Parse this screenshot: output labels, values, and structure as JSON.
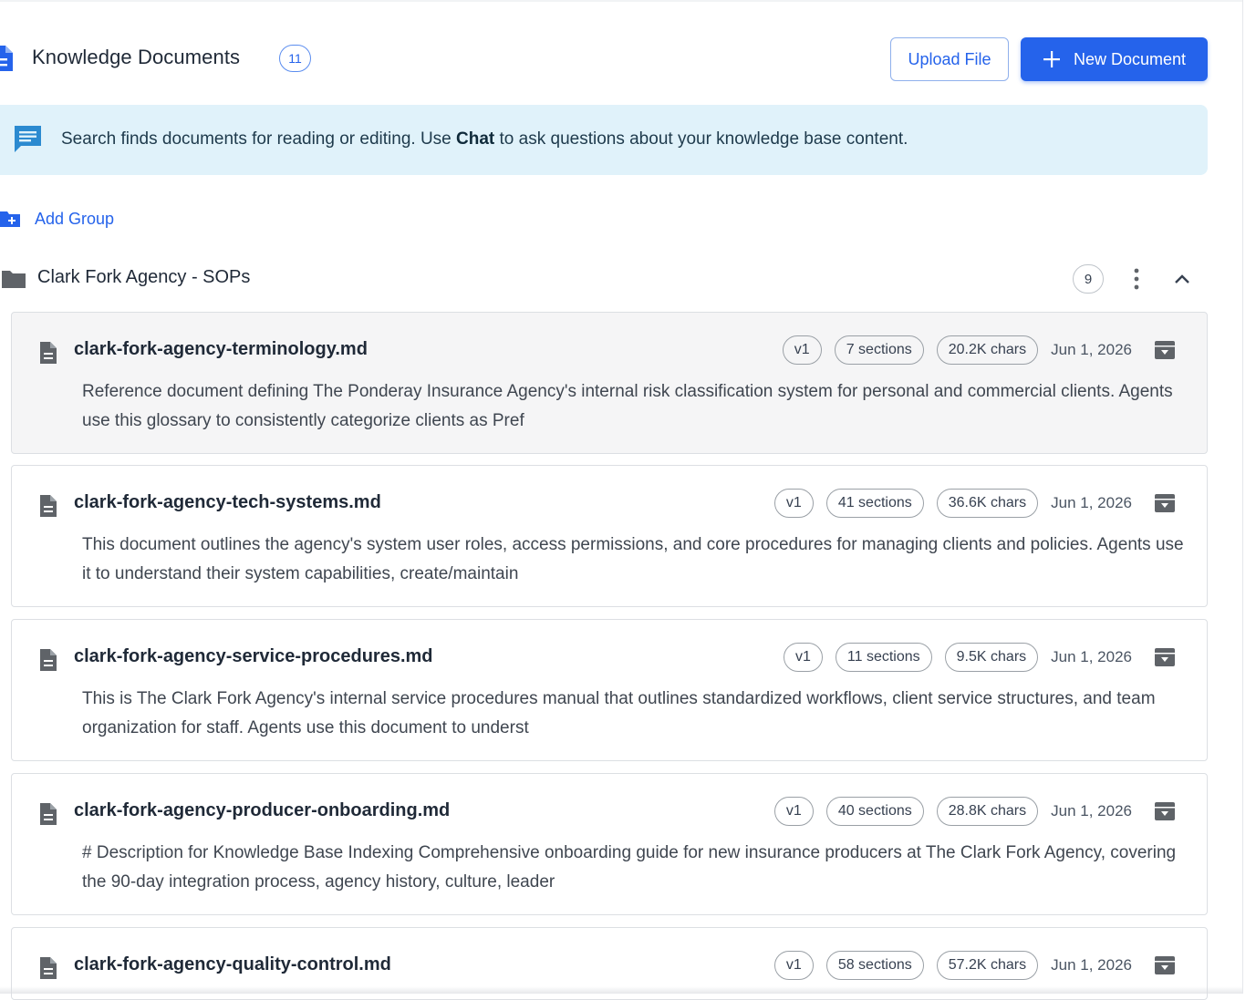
{
  "header": {
    "title": "Knowledge Documents",
    "count": "11",
    "upload_label": "Upload File",
    "new_label": "New Document"
  },
  "banner": {
    "text_before": "Search finds documents for reading or editing. Use ",
    "text_bold": "Chat",
    "text_after": " to ask questions about your knowledge base content."
  },
  "add_group_label": "Add Group",
  "group": {
    "title": "Clark Fork Agency - SOPs",
    "count": "9"
  },
  "documents": [
    {
      "name": "clark-fork-agency-terminology.md",
      "version": "v1",
      "sections": "7 sections",
      "chars": "20.2K chars",
      "date": "Jun 1, 2026",
      "description": "Reference document defining The Ponderay Insurance Agency's internal risk classification system for personal and commercial clients. Agents use this glossary to consistently categorize clients as Pref"
    },
    {
      "name": "clark-fork-agency-tech-systems.md",
      "version": "v1",
      "sections": "41 sections",
      "chars": "36.6K chars",
      "date": "Jun 1, 2026",
      "description": "This document outlines the agency's system user roles, access permissions, and core procedures for managing clients and policies. Agents use it to understand their system capabilities, create/maintain"
    },
    {
      "name": "clark-fork-agency-service-procedures.md",
      "version": "v1",
      "sections": "11 sections",
      "chars": "9.5K chars",
      "date": "Jun 1, 2026",
      "description": "This is The Clark Fork Agency's internal service procedures manual that outlines standardized workflows, client service structures, and team organization for staff. Agents use this document to underst"
    },
    {
      "name": "clark-fork-agency-producer-onboarding.md",
      "version": "v1",
      "sections": "40 sections",
      "chars": "28.8K chars",
      "date": "Jun 1, 2026",
      "description": "# Description for Knowledge Base Indexing Comprehensive onboarding guide for new insurance producers at The Clark Fork Agency, covering the 90-day integration process, agency history, culture, leader"
    },
    {
      "name": "clark-fork-agency-quality-control.md",
      "version": "v1",
      "sections": "58 sections",
      "chars": "57.2K chars",
      "date": "Jun 1, 2026",
      "description": ""
    }
  ]
}
